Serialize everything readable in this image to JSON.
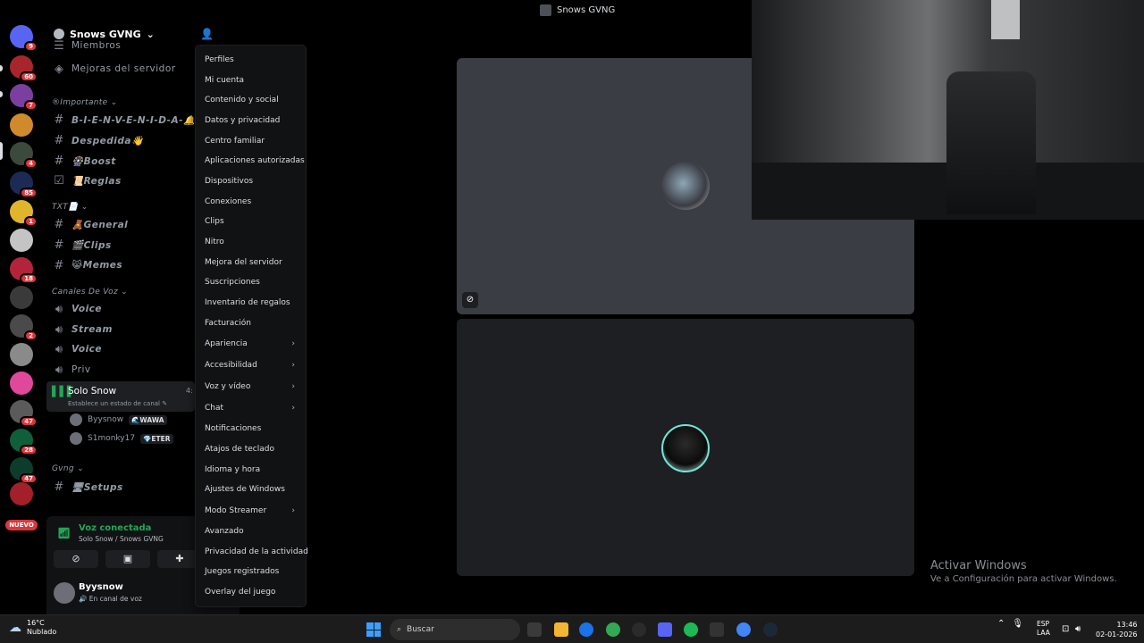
{
  "window": {
    "title": "Snows GVNG"
  },
  "colors": {
    "accent_green": "#23a559",
    "danger_red": "#da373c",
    "bg": "#000000",
    "menu_bg": "#111214"
  },
  "rail": {
    "badges": [
      "9",
      "60",
      "7",
      "4",
      "85",
      "1",
      "18",
      "2",
      "47",
      "28",
      "47"
    ],
    "nuevo_label": "NUEVO"
  },
  "sidebar": {
    "server_name": "Snows GVNG",
    "members": "Miembros",
    "boosts": "Mejoras del servidor",
    "categories": {
      "important": "®Importante",
      "txt": "TXT📄",
      "voice": "Canales De Voz",
      "gvng": "Gvng"
    },
    "channels": {
      "bienvenida": "B-I-E-N-V-E-N-I-D-A-🔔",
      "despedida": "Despedida👋",
      "boost": "🎡Boost",
      "reglas": "📜Reglas",
      "general": "🧸General",
      "clips": "🎬Clips",
      "memes": "😹Memes",
      "voice1": "Voice",
      "stream": "Stream",
      "voice2": "Voice",
      "priv": "Priv",
      "setups": "🖥Setups"
    },
    "active_voice": {
      "name": "Solo Snow",
      "status": "Establece un estado de canal ✎",
      "count": "4:"
    },
    "voice_users": [
      {
        "name": "Byysnow",
        "tag": "🌊WAWA"
      },
      {
        "name": "S1monky17",
        "tag": "💎ETER"
      }
    ]
  },
  "voice_panel": {
    "connected": "Voz conectada",
    "sub": "Solo Snow / Snows GVNG"
  },
  "user_panel": {
    "username": "Byysnow",
    "status": "🔊 En canal de voz"
  },
  "menu": {
    "items": [
      {
        "label": "Perfiles",
        "arrow": false
      },
      {
        "label": "Mi cuenta",
        "arrow": false
      },
      {
        "label": "Contenido y social",
        "arrow": false
      },
      {
        "label": "Datos y privacidad",
        "arrow": false
      },
      {
        "label": "Centro familiar",
        "arrow": false
      },
      {
        "label": "Aplicaciones autorizadas",
        "arrow": false
      },
      {
        "label": "Dispositivos",
        "arrow": false
      },
      {
        "label": "Conexiones",
        "arrow": false
      },
      {
        "label": "Clips",
        "arrow": false
      },
      {
        "label": "Nitro",
        "arrow": false
      },
      {
        "label": "Mejora del servidor",
        "arrow": false
      },
      {
        "label": "Suscripciones",
        "arrow": false
      },
      {
        "label": "Inventario de regalos",
        "arrow": false
      },
      {
        "label": "Facturación",
        "arrow": false
      },
      {
        "label": "Apariencia",
        "arrow": true
      },
      {
        "label": "Accesibilidad",
        "arrow": true
      },
      {
        "label": "Voz y vídeo",
        "arrow": true
      },
      {
        "label": "Chat",
        "arrow": true
      },
      {
        "label": "Notificaciones",
        "arrow": false
      },
      {
        "label": "Atajos de teclado",
        "arrow": false
      },
      {
        "label": "Idioma y hora",
        "arrow": false
      },
      {
        "label": "Ajustes de Windows",
        "arrow": false
      },
      {
        "label": "Modo Streamer",
        "arrow": true
      },
      {
        "label": "Avanzado",
        "arrow": false
      },
      {
        "label": "Privacidad de la actividad",
        "arrow": false
      },
      {
        "label": "Juegos registrados",
        "arrow": false
      },
      {
        "label": "Overlay del juego",
        "arrow": false
      }
    ]
  },
  "watermark": {
    "line1": "Activar Windows",
    "line2": "Ve a Configuración para activar Windows."
  },
  "taskbar": {
    "temp": "16°C",
    "weather": "Nublado",
    "search_placeholder": "Buscar",
    "lang1": "ESP",
    "lang2": "LAA",
    "time": "13:46",
    "date": "02-01-2026"
  }
}
